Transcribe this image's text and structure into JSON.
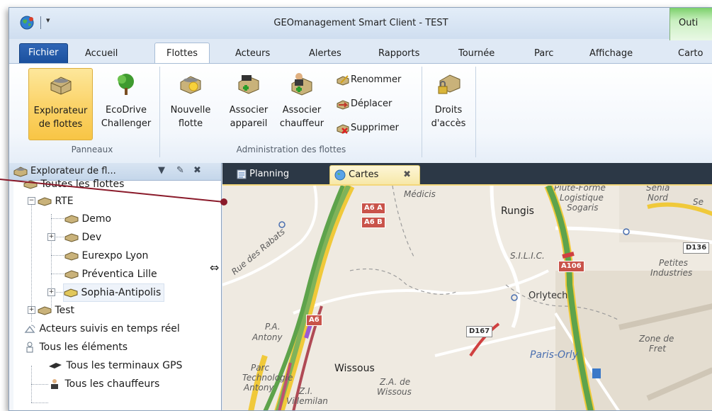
{
  "window": {
    "title": "GEOmanagement Smart Client - TEST",
    "context_tab_label": "Outi",
    "colors": {
      "accent": "#1a4f9c",
      "selected": "#fbd46b",
      "context": "#7bd06a",
      "panel_header": "#c4d6ea",
      "map_bg": "#efeae1"
    }
  },
  "quick_access": {
    "globe_icon": "globe-icon",
    "dropdown_icon": "dropdown-icon"
  },
  "tabs": [
    {
      "label": "Fichier"
    },
    {
      "label": "Accueil"
    },
    {
      "label": "Flottes"
    },
    {
      "label": "Acteurs"
    },
    {
      "label": "Alertes"
    },
    {
      "label": "Rapports"
    },
    {
      "label": "Tournée"
    },
    {
      "label": "Parc"
    },
    {
      "label": "Affichage"
    },
    {
      "label": "Carto"
    }
  ],
  "ribbon": {
    "panneaux": {
      "label": "Panneaux",
      "explorer": {
        "line1": "Explorateur",
        "line2": "de flottes"
      },
      "ecodrive": {
        "line1": "EcoDrive",
        "line2": "Challenger"
      }
    },
    "admin": {
      "label": "Administration des flottes",
      "nouvelle": {
        "line1": "Nouvelle",
        "line2": "flotte"
      },
      "assoc_app": {
        "line1": "Associer",
        "line2": "appareil"
      },
      "assoc_ch": {
        "line1": "Associer",
        "line2": "chauffeur"
      },
      "renommer": "Renommer",
      "deplacer": "Déplacer",
      "supprimer": "Supprimer",
      "droits": {
        "line1": "Droits",
        "line2": "d'accès"
      }
    }
  },
  "left_panel": {
    "title": "Explorateur de fl...",
    "tree": [
      {
        "label": "Toutes les flottes"
      },
      {
        "label": "RTE"
      },
      {
        "label": "Demo"
      },
      {
        "label": "Dev"
      },
      {
        "label": "Eurexpo Lyon"
      },
      {
        "label": "Préventica Lille"
      },
      {
        "label": "Sophia-Antipolis"
      },
      {
        "label": "Test"
      },
      {
        "label": "Acteurs suivis en temps réel"
      },
      {
        "label": "Tous les éléments"
      },
      {
        "label": "Tous les terminaux GPS"
      },
      {
        "label": "Tous les chauffeurs"
      }
    ]
  },
  "doc_tabs": [
    {
      "label": "Planning"
    },
    {
      "label": "Cartes"
    }
  ],
  "map": {
    "labels": {
      "medicis": "Médicis",
      "rungis": "Rungis",
      "pluteforme": "Plute-Forme",
      "logistique": "Logistique",
      "sogaris": "Sogaris",
      "senia": "Senia",
      "nord": "Nord",
      "se": "Se",
      "silic": "S.I.L.I.C.",
      "petites": "Petites",
      "industries": "Industries",
      "rabats": "Rue des Rabats",
      "orlytech": "Orlytech",
      "pa": "P.A.",
      "antony": "Antony",
      "zonede": "Zone de",
      "fret": "Fret",
      "parisorly": "Paris-Orly",
      "wissous": "Wissous",
      "parc": "Parc",
      "technologie": "Technologie",
      "antony2": "Antony",
      "zi": "Z.I.",
      "villemilan": "Villemilan",
      "za": "Z.A. de",
      "wissous2": "Wissous"
    },
    "shields": {
      "a6a": "A6 A",
      "a6b": "A6 B",
      "d136": "D136",
      "a106": "A106",
      "d167": "D167",
      "a6": "A6"
    }
  }
}
